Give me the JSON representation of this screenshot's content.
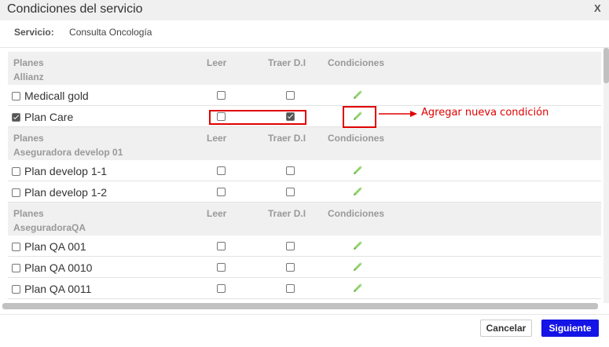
{
  "dialog": {
    "title": "Condiciones del servicio",
    "close": "X"
  },
  "service": {
    "label": "Servicio:",
    "value": "Consulta Oncología"
  },
  "columns": {
    "planes": "Planes",
    "leer": "Leer",
    "traer": "Traer D.I",
    "condiciones": "Condiciones"
  },
  "groups": [
    {
      "name": "Allianz",
      "plans": [
        {
          "name": "Medicall gold",
          "selected": false,
          "leer": false,
          "traer": false
        },
        {
          "name": "Plan Care",
          "selected": true,
          "leer": false,
          "traer": true
        }
      ]
    },
    {
      "name": "Aseguradora develop 01",
      "plans": [
        {
          "name": "Plan develop 1-1",
          "selected": false,
          "leer": false,
          "traer": false
        },
        {
          "name": "Plan develop 1-2",
          "selected": false,
          "leer": false,
          "traer": false
        }
      ]
    },
    {
      "name": "AseguradoraQA",
      "plans": [
        {
          "name": "Plan QA 001",
          "selected": false,
          "leer": false,
          "traer": false
        },
        {
          "name": "Plan QA 0010",
          "selected": false,
          "leer": false,
          "traer": false
        },
        {
          "name": "Plan QA 0011",
          "selected": false,
          "leer": false,
          "traer": false
        }
      ]
    }
  ],
  "annotation": {
    "text": "Agregar nueva condición",
    "color": "#e00000"
  },
  "footer": {
    "cancel": "Cancelar",
    "next": "Siguiente"
  },
  "colors": {
    "accent": "#1414e6",
    "edit_icon": "#8fd16a",
    "header_bg": "#f0f0f0"
  },
  "icons": {
    "edit": "pencil-icon"
  }
}
